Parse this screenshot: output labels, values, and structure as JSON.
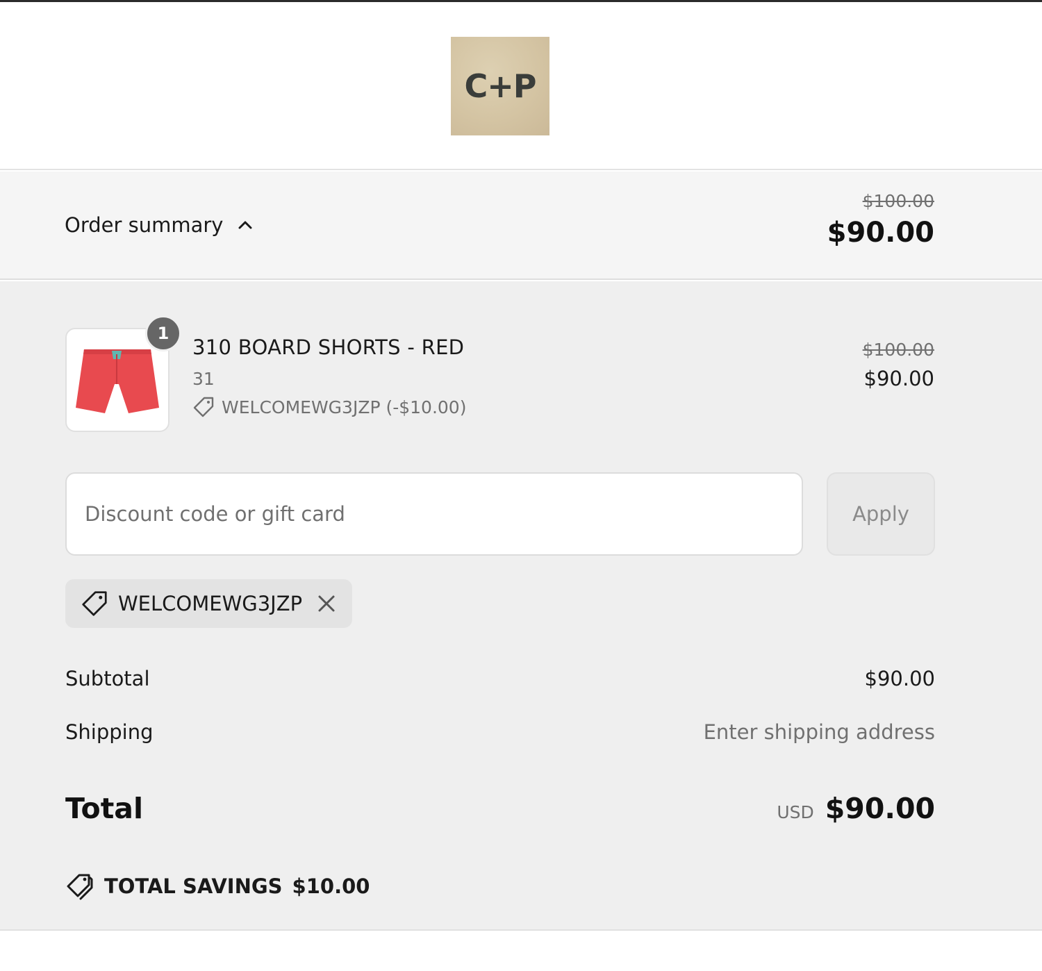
{
  "store": {
    "logo_text": "C+P"
  },
  "summary_bar": {
    "toggle_label": "Order summary",
    "original_total": "$100.00",
    "total": "$90.00"
  },
  "line_item": {
    "quantity": "1",
    "name": "310 BOARD SHORTS - RED",
    "variant": "31",
    "discount": "WELCOMEWG3JZP (-$10.00)",
    "original_price": "$100.00",
    "price": "$90.00"
  },
  "discount_form": {
    "placeholder": "Discount code or gift card",
    "value": "",
    "apply_label": "Apply"
  },
  "applied_code": {
    "label": "WELCOMEWG3JZP"
  },
  "totals": {
    "subtotal_label": "Subtotal",
    "subtotal_value": "$90.00",
    "shipping_label": "Shipping",
    "shipping_value": "Enter shipping address",
    "total_label": "Total",
    "currency": "USD",
    "total_value": "$90.00"
  },
  "savings": {
    "label": "TOTAL SAVINGS",
    "value": "$10.00"
  },
  "colors": {
    "page_bg": "#ffffff",
    "summary_bar_bg": "#f5f5f5",
    "panel_bg": "#efefef",
    "muted_text": "#707070",
    "badge_bg": "#666666",
    "product_red": "#e84a4f",
    "waistband_teal": "#5fb7b0"
  }
}
